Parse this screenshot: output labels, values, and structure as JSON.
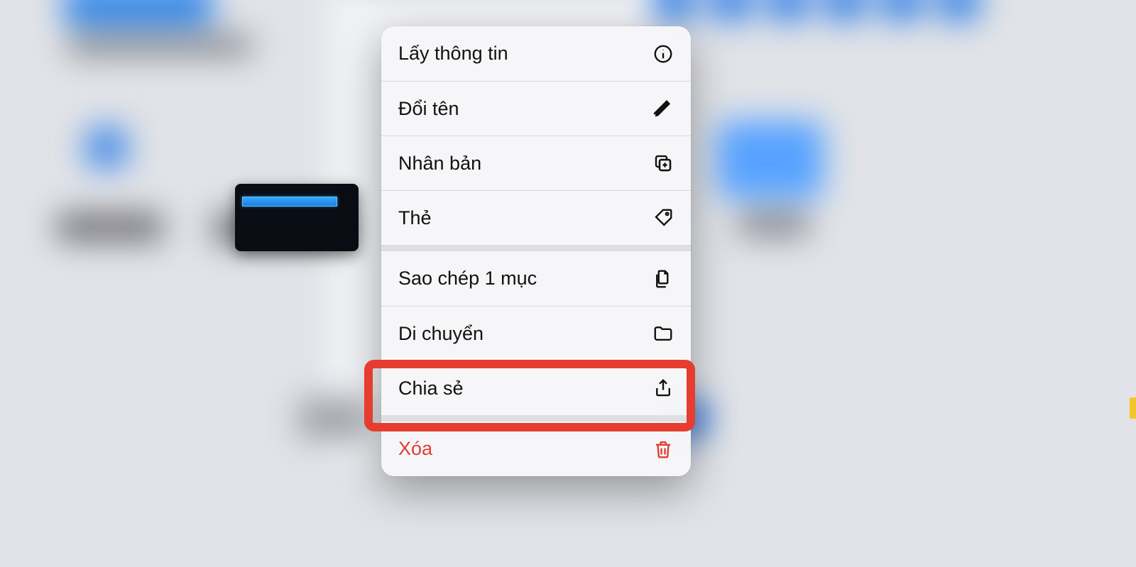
{
  "menu": {
    "get_info": {
      "label": "Lấy thông tin",
      "icon": "info-circle-icon"
    },
    "rename": {
      "label": "Đổi tên",
      "icon": "pencil-icon"
    },
    "duplicate": {
      "label": "Nhân bản",
      "icon": "duplicate-icon"
    },
    "tags": {
      "label": "Thẻ",
      "icon": "tag-icon"
    },
    "copy_one": {
      "label": "Sao chép 1 mục",
      "icon": "doc-on-doc-icon"
    },
    "move": {
      "label": "Di chuyển",
      "icon": "folder-icon"
    },
    "share": {
      "label": "Chia sẻ",
      "icon": "share-icon"
    },
    "delete": {
      "label": "Xóa",
      "icon": "trash-icon"
    }
  },
  "highlighted_action": "share"
}
